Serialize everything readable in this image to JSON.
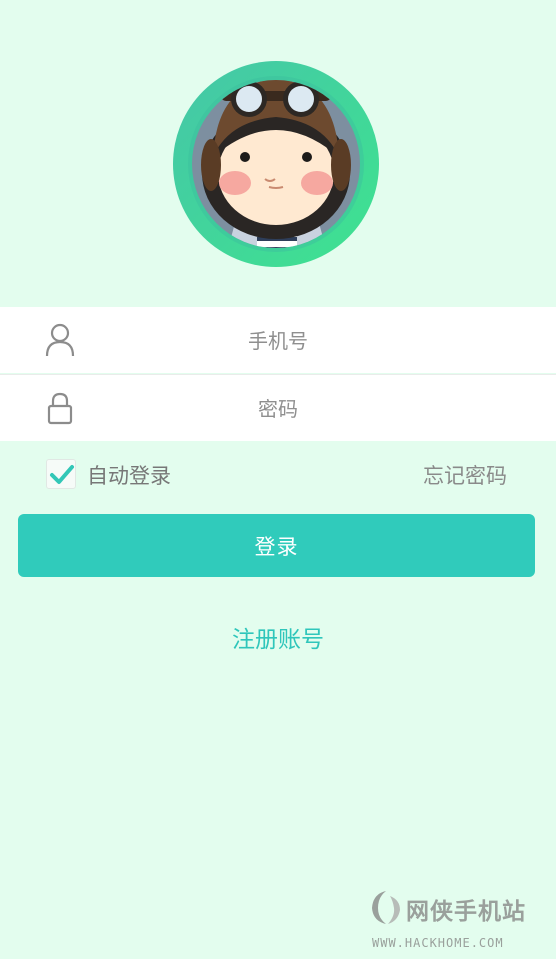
{
  "login": {
    "phone_placeholder": "手机号",
    "password_placeholder": "密码",
    "auto_login_label": "自动登录",
    "auto_login_checked": true,
    "forgot_password": "忘记密码",
    "login_button": "登录",
    "register_link": "注册账号"
  },
  "icons": {
    "user": "user-icon",
    "lock": "lock-icon",
    "check": "checkmark-icon",
    "watermark": "hackhome-logo"
  },
  "colors": {
    "background": "#e3fdee",
    "accent": "#30cbbb",
    "link": "#2fc6bb",
    "ring_start": "#40c7a6",
    "ring_end": "#3fe08e"
  },
  "watermark": {
    "title": "网侠手机站",
    "url": "WWW.HACKHOME.COM"
  }
}
